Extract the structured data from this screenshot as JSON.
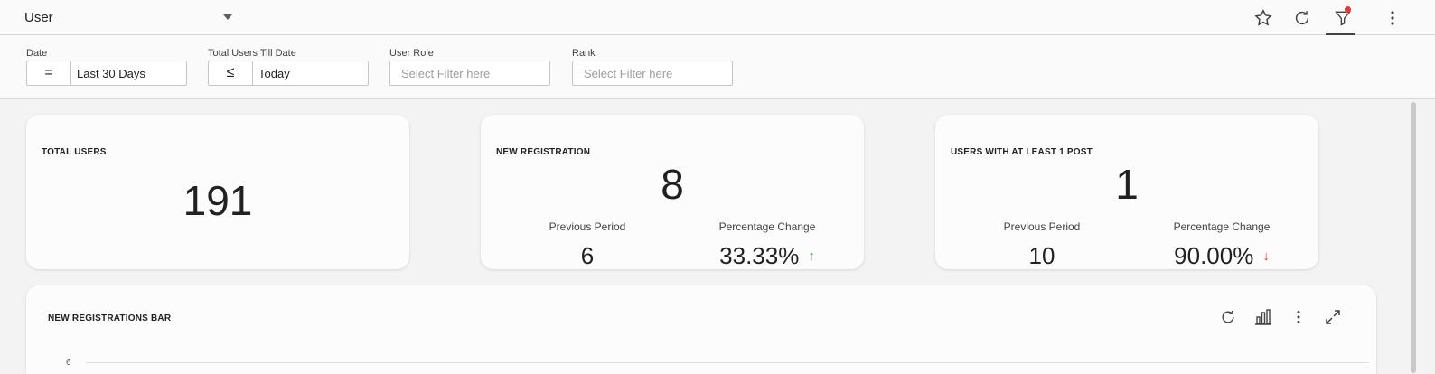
{
  "header": {
    "dashboard_select": "User",
    "icons": [
      "star-icon",
      "refresh-icon",
      "filter-icon",
      "more-vertical-icon"
    ],
    "filter_indicator_color": "#e53935"
  },
  "filters": [
    {
      "label": "Date",
      "operator": "=",
      "value": "Last 30 Days"
    },
    {
      "label": "Total Users Till Date",
      "operator": "≤",
      "value": "Today"
    },
    {
      "label": "User Role",
      "placeholder": "Select Filter here"
    },
    {
      "label": "Rank",
      "placeholder": "Select Filter here"
    }
  ],
  "cards": {
    "total_users": {
      "title": "TOTAL USERS",
      "value": "191"
    },
    "new_registration": {
      "title": "NEW REGISTRATION",
      "value": "8",
      "previous_label": "Previous Period",
      "previous_value": "6",
      "change_label": "Percentage Change",
      "change_value": "33.33%",
      "change_direction": "up"
    },
    "users_with_post": {
      "title": "USERS WITH AT LEAST 1 POST",
      "value": "1",
      "previous_label": "Previous Period",
      "previous_value": "10",
      "change_label": "Percentage Change",
      "change_value": "90.00%",
      "change_direction": "down"
    }
  },
  "bar_card": {
    "title": "NEW REGISTRATIONS BAR",
    "icons": [
      "refresh-icon",
      "bar-chart-icon",
      "more-vertical-icon",
      "expand-icon"
    ],
    "y_tick": "6"
  },
  "colors": {
    "up": "#43a047",
    "down": "#e53935"
  }
}
